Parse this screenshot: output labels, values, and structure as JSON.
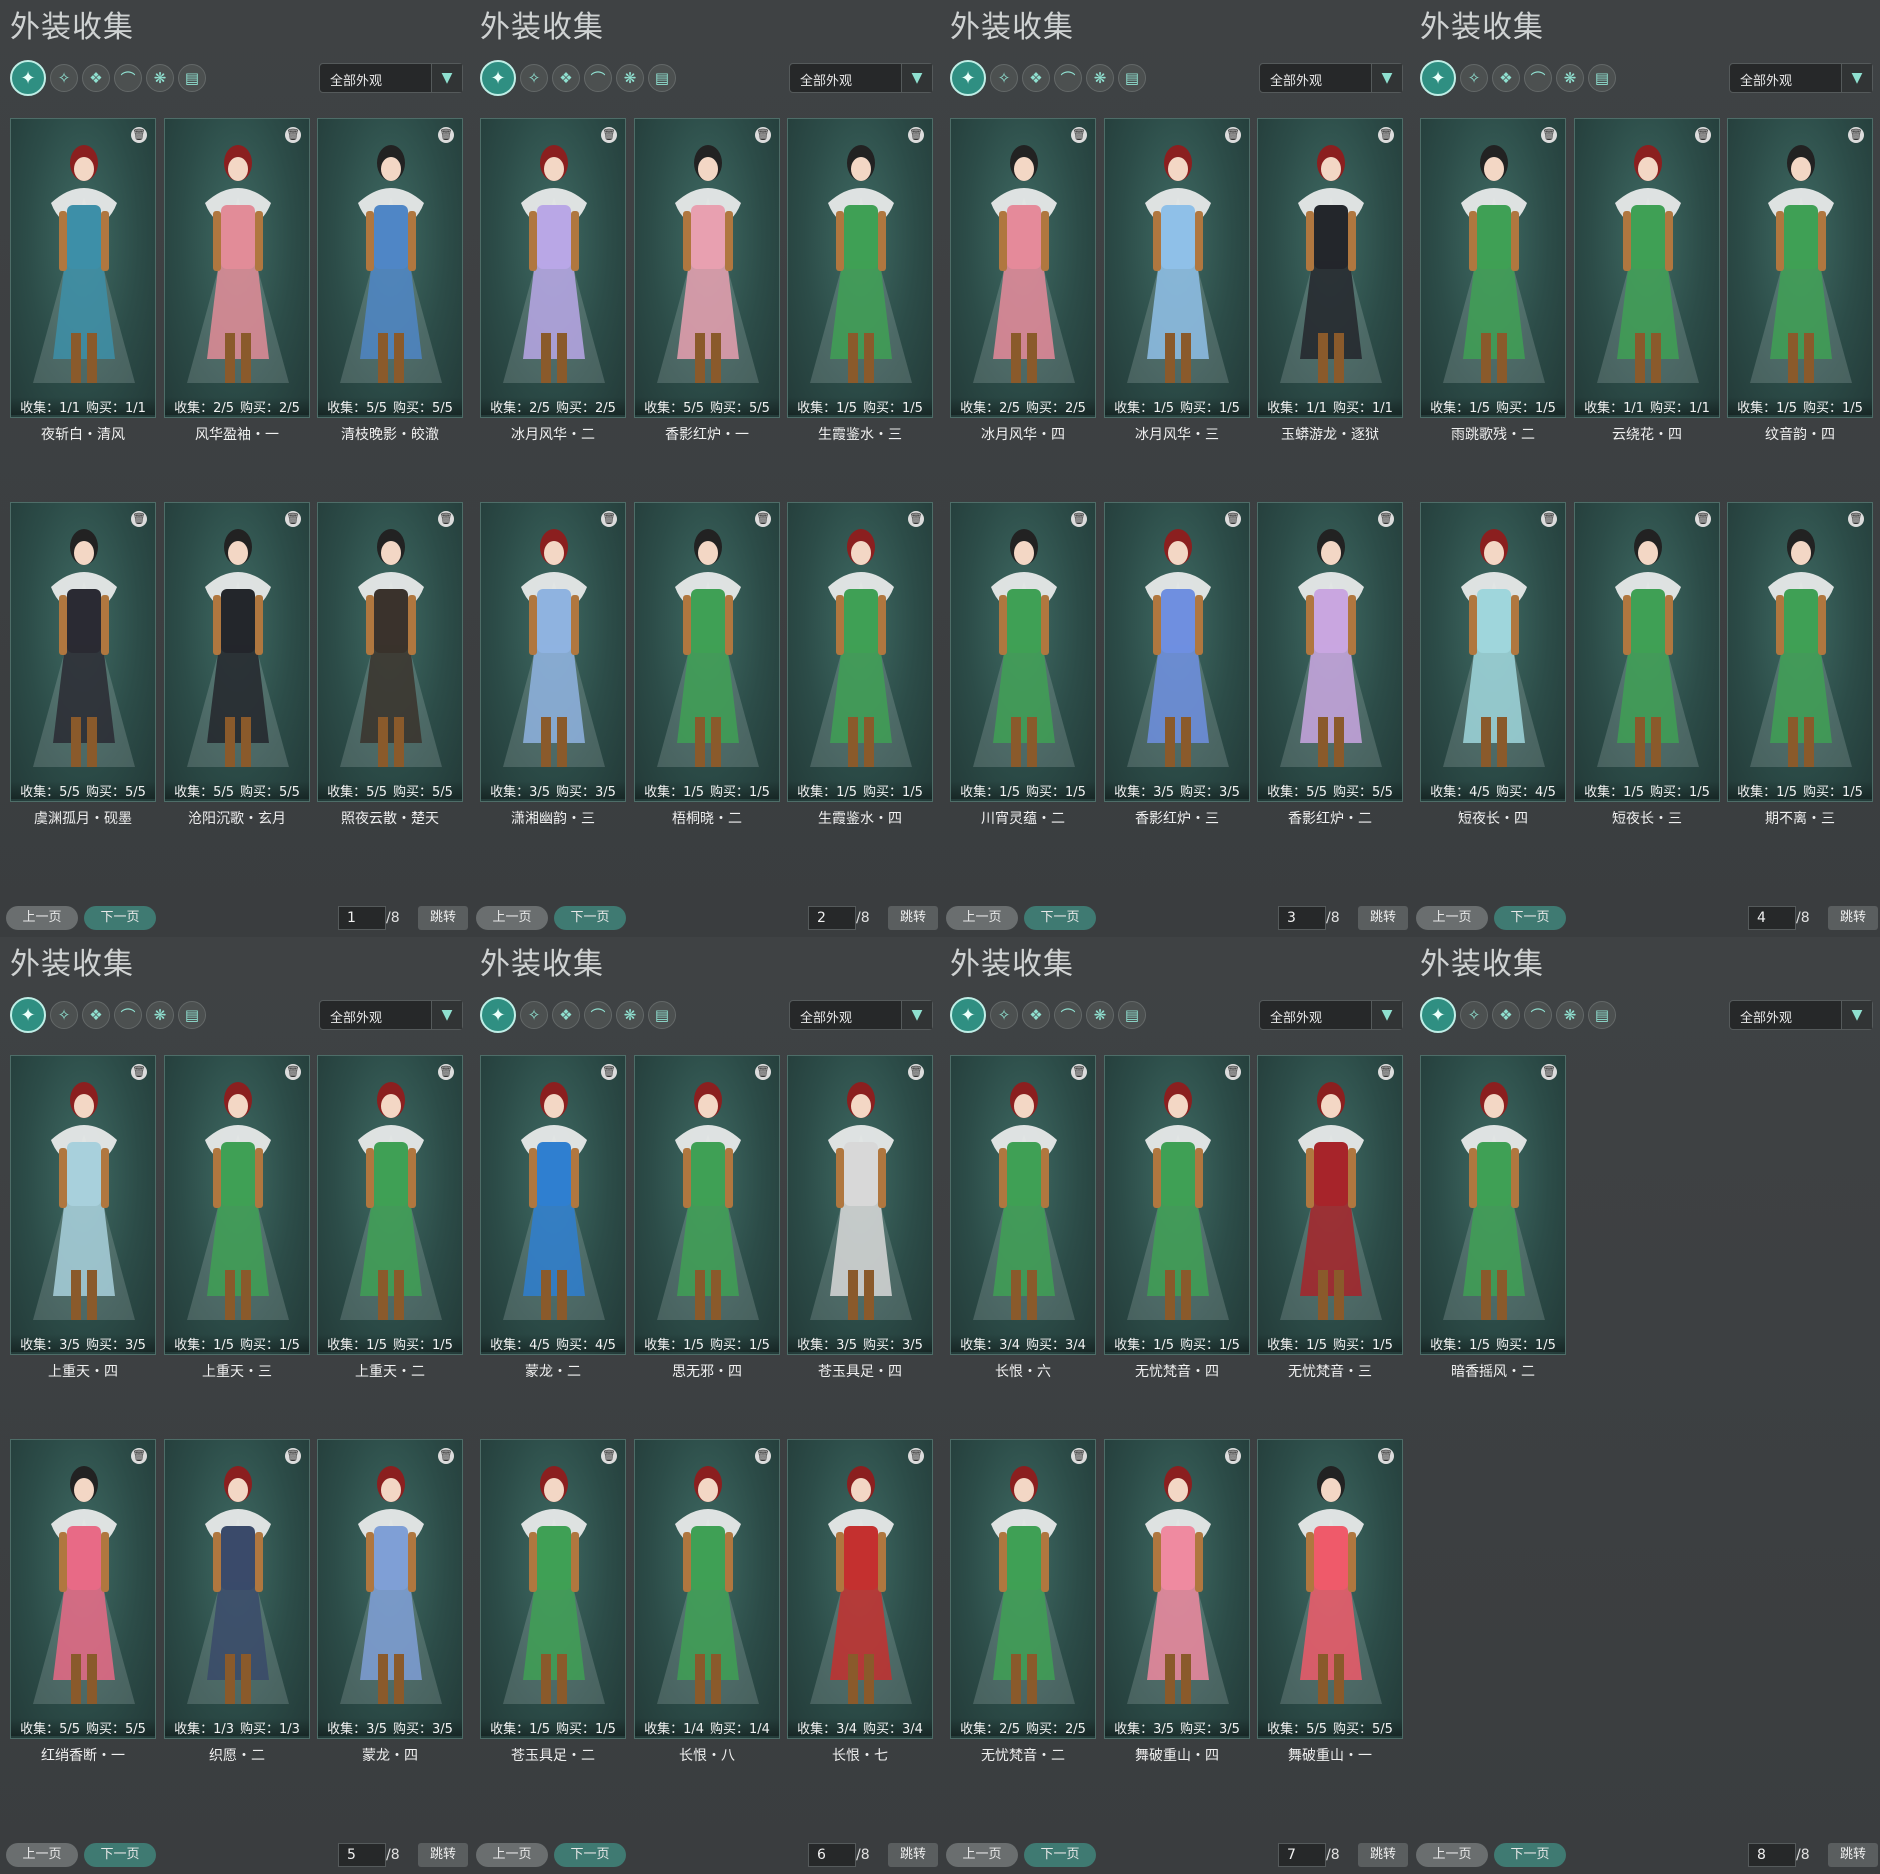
{
  "panels": [
    {
      "title": "外装收集",
      "filter": "全部外观",
      "page": "1",
      "total": "/8",
      "prev": "上一页",
      "next": "下一页",
      "jump": "跳转",
      "items": [
        {
          "name": "夜斩白・清风",
          "collect": "收集：1/1",
          "buy": "购买：1/1",
          "outfit": "#3d8fa8",
          "hair": "#8b1f1f"
        },
        {
          "name": "风华盈袖・一",
          "collect": "收集：2/5",
          "buy": "购买：2/5",
          "outfit": "#e28c98",
          "hair": "#8b1f1f"
        },
        {
          "name": "清枝晚影・皎澈",
          "collect": "收集：5/5",
          "buy": "购买：5/5",
          "outfit": "#4f86c6",
          "hair": "#222222"
        },
        {
          "name": "虞渊孤月・砚墨",
          "collect": "收集：5/5",
          "buy": "购买：5/5",
          "outfit": "#2a2a33",
          "hair": "#222222"
        },
        {
          "name": "沧阳沉歌・玄月",
          "collect": "收集：5/5",
          "buy": "购买：5/5",
          "outfit": "#23262b",
          "hair": "#222222"
        },
        {
          "name": "照夜云散・楚天",
          "collect": "收集：5/5",
          "buy": "购买：5/5",
          "outfit": "#3a322c",
          "hair": "#222222"
        }
      ]
    },
    {
      "title": "外装收集",
      "filter": "全部外观",
      "page": "2",
      "total": "/8",
      "prev": "上一页",
      "next": "下一页",
      "jump": "跳转",
      "items": [
        {
          "name": "冰月风华・二",
          "collect": "收集：2/5",
          "buy": "购买：2/5",
          "outfit": "#b9a7e6",
          "hair": "#8b1f1f"
        },
        {
          "name": "香影红炉・一",
          "collect": "收集：5/5",
          "buy": "购买：5/5",
          "outfit": "#e8a0b0",
          "hair": "#222222"
        },
        {
          "name": "生霞鉴水・三",
          "collect": "收集：1/5",
          "buy": "购买：1/5",
          "outfit": "#3fa055",
          "hair": "#222222"
        },
        {
          "name": "潇湘幽韵・三",
          "collect": "收集：3/5",
          "buy": "购买：3/5",
          "outfit": "#8fb3e0",
          "hair": "#8b1f1f"
        },
        {
          "name": "梧桐晓・二",
          "collect": "收集：1/5",
          "buy": "购买：1/5",
          "outfit": "#3fa055",
          "hair": "#222222"
        },
        {
          "name": "生霞鉴水・四",
          "collect": "收集：1/5",
          "buy": "购买：1/5",
          "outfit": "#3fa055",
          "hair": "#8b1f1f"
        }
      ]
    },
    {
      "title": "外装收集",
      "filter": "全部外观",
      "page": "3",
      "total": "/8",
      "prev": "上一页",
      "next": "下一页",
      "jump": "跳转",
      "items": [
        {
          "name": "冰月风华・四",
          "collect": "收集：2/5",
          "buy": "购买：2/5",
          "outfit": "#e58a9a",
          "hair": "#222222"
        },
        {
          "name": "冰月风华・三",
          "collect": "收集：1/5",
          "buy": "购买：1/5",
          "outfit": "#8fc0e8",
          "hair": "#8b1f1f"
        },
        {
          "name": "玉蟒游龙・逐狱",
          "collect": "收集：1/1",
          "buy": "购买：1/1",
          "outfit": "#23262b",
          "hair": "#8b1f1f"
        },
        {
          "name": "川宵灵蕴・二",
          "collect": "收集：1/5",
          "buy": "购买：1/5",
          "outfit": "#3fa055",
          "hair": "#222222"
        },
        {
          "name": "香影红炉・三",
          "collect": "收集：3/5",
          "buy": "购买：3/5",
          "outfit": "#6f8fe0",
          "hair": "#8b1f1f"
        },
        {
          "name": "香影红炉・二",
          "collect": "收集：5/5",
          "buy": "购买：5/5",
          "outfit": "#c9a6e0",
          "hair": "#222222"
        }
      ]
    },
    {
      "title": "外装收集",
      "filter": "全部外观",
      "page": "4",
      "total": "/8",
      "prev": "上一页",
      "next": "下一页",
      "jump": "跳转",
      "items": [
        {
          "name": "雨跳歌残・二",
          "collect": "收集：1/5",
          "buy": "购买：1/5",
          "outfit": "#3fa055",
          "hair": "#222222"
        },
        {
          "name": "云绕花・四",
          "collect": "收集：1/1",
          "buy": "购买：1/1",
          "outfit": "#3fa055",
          "hair": "#8b1f1f"
        },
        {
          "name": "纹音韵・四",
          "collect": "收集：1/5",
          "buy": "购买：1/5",
          "outfit": "#3fa055",
          "hair": "#222222"
        },
        {
          "name": "短夜长・四",
          "collect": "收集：4/5",
          "buy": "购买：4/5",
          "outfit": "#9fd6dc",
          "hair": "#8b1f1f"
        },
        {
          "name": "短夜长・三",
          "collect": "收集：1/5",
          "buy": "购买：1/5",
          "outfit": "#3fa055",
          "hair": "#222222"
        },
        {
          "name": "期不离・三",
          "collect": "收集：1/5",
          "buy": "购买：1/5",
          "outfit": "#3fa055",
          "hair": "#222222"
        }
      ]
    },
    {
      "title": "外装收集",
      "filter": "全部外观",
      "page": "5",
      "total": "/8",
      "prev": "上一页",
      "next": "下一页",
      "jump": "跳转",
      "items": [
        {
          "name": "上重天・四",
          "collect": "收集：3/5",
          "buy": "购买：3/5",
          "outfit": "#a8d0dc",
          "hair": "#8b1f1f"
        },
        {
          "name": "上重天・三",
          "collect": "收集：1/5",
          "buy": "购买：1/5",
          "outfit": "#3fa055",
          "hair": "#8b1f1f"
        },
        {
          "name": "上重天・二",
          "collect": "收集：1/5",
          "buy": "购买：1/5",
          "outfit": "#3fa055",
          "hair": "#8b1f1f"
        },
        {
          "name": "红绡香断・一",
          "collect": "收集：5/5",
          "buy": "购买：5/5",
          "outfit": "#e86a86",
          "hair": "#222222"
        },
        {
          "name": "织愿・二",
          "collect": "收集：1/3",
          "buy": "购买：1/3",
          "outfit": "#3a4a6a",
          "hair": "#8b1f1f"
        },
        {
          "name": "蒙龙・四",
          "collect": "收集：3/5",
          "buy": "购买：3/5",
          "outfit": "#7f9fd6",
          "hair": "#8b1f1f"
        }
      ]
    },
    {
      "title": "外装收集",
      "filter": "全部外观",
      "page": "6",
      "total": "/8",
      "prev": "上一页",
      "next": "下一页",
      "jump": "跳转",
      "items": [
        {
          "name": "蒙龙・二",
          "collect": "收集：4/5",
          "buy": "购买：4/5",
          "outfit": "#2f7fd0",
          "hair": "#8b1f1f"
        },
        {
          "name": "思无邪・四",
          "collect": "收集：1/5",
          "buy": "购买：1/5",
          "outfit": "#3fa055",
          "hair": "#8b1f1f"
        },
        {
          "name": "苍玉具足・四",
          "collect": "收集：3/5",
          "buy": "购买：3/5",
          "outfit": "#d8d8d8",
          "hair": "#8b1f1f"
        },
        {
          "name": "苍玉具足・二",
          "collect": "收集：1/5",
          "buy": "购买：1/5",
          "outfit": "#3fa055",
          "hair": "#8b1f1f"
        },
        {
          "name": "长恨・八",
          "collect": "收集：1/4",
          "buy": "购买：1/4",
          "outfit": "#3fa055",
          "hair": "#8b1f1f"
        },
        {
          "name": "长恨・七",
          "collect": "收集：3/4",
          "buy": "购买：3/4",
          "outfit": "#c4302f",
          "hair": "#8b1f1f"
        }
      ]
    },
    {
      "title": "外装收集",
      "filter": "全部外观",
      "page": "7",
      "total": "/8",
      "prev": "上一页",
      "next": "下一页",
      "jump": "跳转",
      "items": [
        {
          "name": "长恨・六",
          "collect": "收集：3/4",
          "buy": "购买：3/4",
          "outfit": "#3fa055",
          "hair": "#8b1f1f"
        },
        {
          "name": "无忧梵音・四",
          "collect": "收集：1/5",
          "buy": "购买：1/5",
          "outfit": "#3fa055",
          "hair": "#8b1f1f"
        },
        {
          "name": "无忧梵音・三",
          "collect": "收集：1/5",
          "buy": "购买：1/5",
          "outfit": "#a7242a",
          "hair": "#8b1f1f"
        },
        {
          "name": "无忧梵音・二",
          "collect": "收集：2/5",
          "buy": "购买：2/5",
          "outfit": "#3fa055",
          "hair": "#8b1f1f"
        },
        {
          "name": "舞破重山・四",
          "collect": "收集：3/5",
          "buy": "购买：3/5",
          "outfit": "#ef8aa0",
          "hair": "#8b1f1f"
        },
        {
          "name": "舞破重山・一",
          "collect": "收集：5/5",
          "buy": "购买：5/5",
          "outfit": "#ef5a6a",
          "hair": "#222222"
        }
      ]
    },
    {
      "title": "外装收集",
      "filter": "全部外观",
      "page": "8",
      "total": "/8",
      "prev": "上一页",
      "next": "下一页",
      "jump": "跳转",
      "items": [
        {
          "name": "暗香摇风・二",
          "collect": "收集：1/5",
          "buy": "购买：1/5",
          "outfit": "#3fa055",
          "hair": "#8b1f1f"
        }
      ]
    }
  ],
  "tab_icons": [
    "outfit-all-icon",
    "top-icon",
    "dress-icon",
    "shoe-icon",
    "mask-icon",
    "pants-icon"
  ]
}
